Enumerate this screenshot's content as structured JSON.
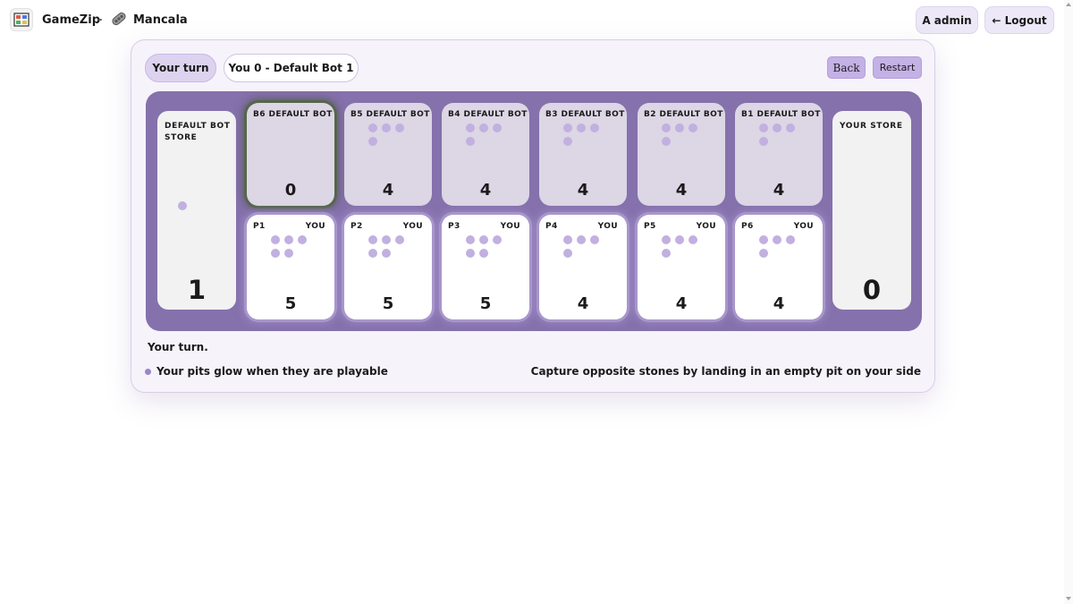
{
  "header": {
    "app_name": "GameZip",
    "separator": "-",
    "game_name": "Mancala",
    "logo_icon": "gamezip-logo-icon",
    "game_icon": "mancala-icon",
    "user_button": "A admin",
    "logout_button": "← Logout"
  },
  "game": {
    "turn_pill": "Your turn",
    "score_pill": "You 0 - Default Bot 1",
    "back_label": "Back",
    "restart_label": "Restart",
    "status_text": "Your turn.",
    "hint_left": "Your pits glow when they are playable",
    "hint_right": "Capture opposite stones by landing in an empty pit on your side"
  },
  "board": {
    "bot_store": {
      "label": "DEFAULT BOT STORE",
      "count": 1
    },
    "your_store": {
      "label": "YOUR STORE",
      "count": 0
    },
    "bot_pits": [
      {
        "label": "B6 DEFAULT BOT",
        "count": 0,
        "selected": true
      },
      {
        "label": "B5 DEFAULT BOT",
        "count": 4
      },
      {
        "label": "B4 DEFAULT BOT",
        "count": 4
      },
      {
        "label": "B3 DEFAULT BOT",
        "count": 4
      },
      {
        "label": "B2 DEFAULT BOT",
        "count": 4
      },
      {
        "label": "B1 DEFAULT BOT",
        "count": 4
      }
    ],
    "your_pits": [
      {
        "label": "P1",
        "owner": "YOU",
        "count": 5
      },
      {
        "label": "P2",
        "owner": "YOU",
        "count": 5
      },
      {
        "label": "P3",
        "owner": "YOU",
        "count": 5
      },
      {
        "label": "P4",
        "owner": "YOU",
        "count": 4
      },
      {
        "label": "P5",
        "owner": "YOU",
        "count": 4
      },
      {
        "label": "P6",
        "owner": "YOU",
        "count": 4
      }
    ]
  },
  "colors": {
    "board": "#8571ac",
    "stone": "#c1b0e0",
    "accent_button": "#c4b1e5",
    "selected_ring": "#56664c"
  }
}
